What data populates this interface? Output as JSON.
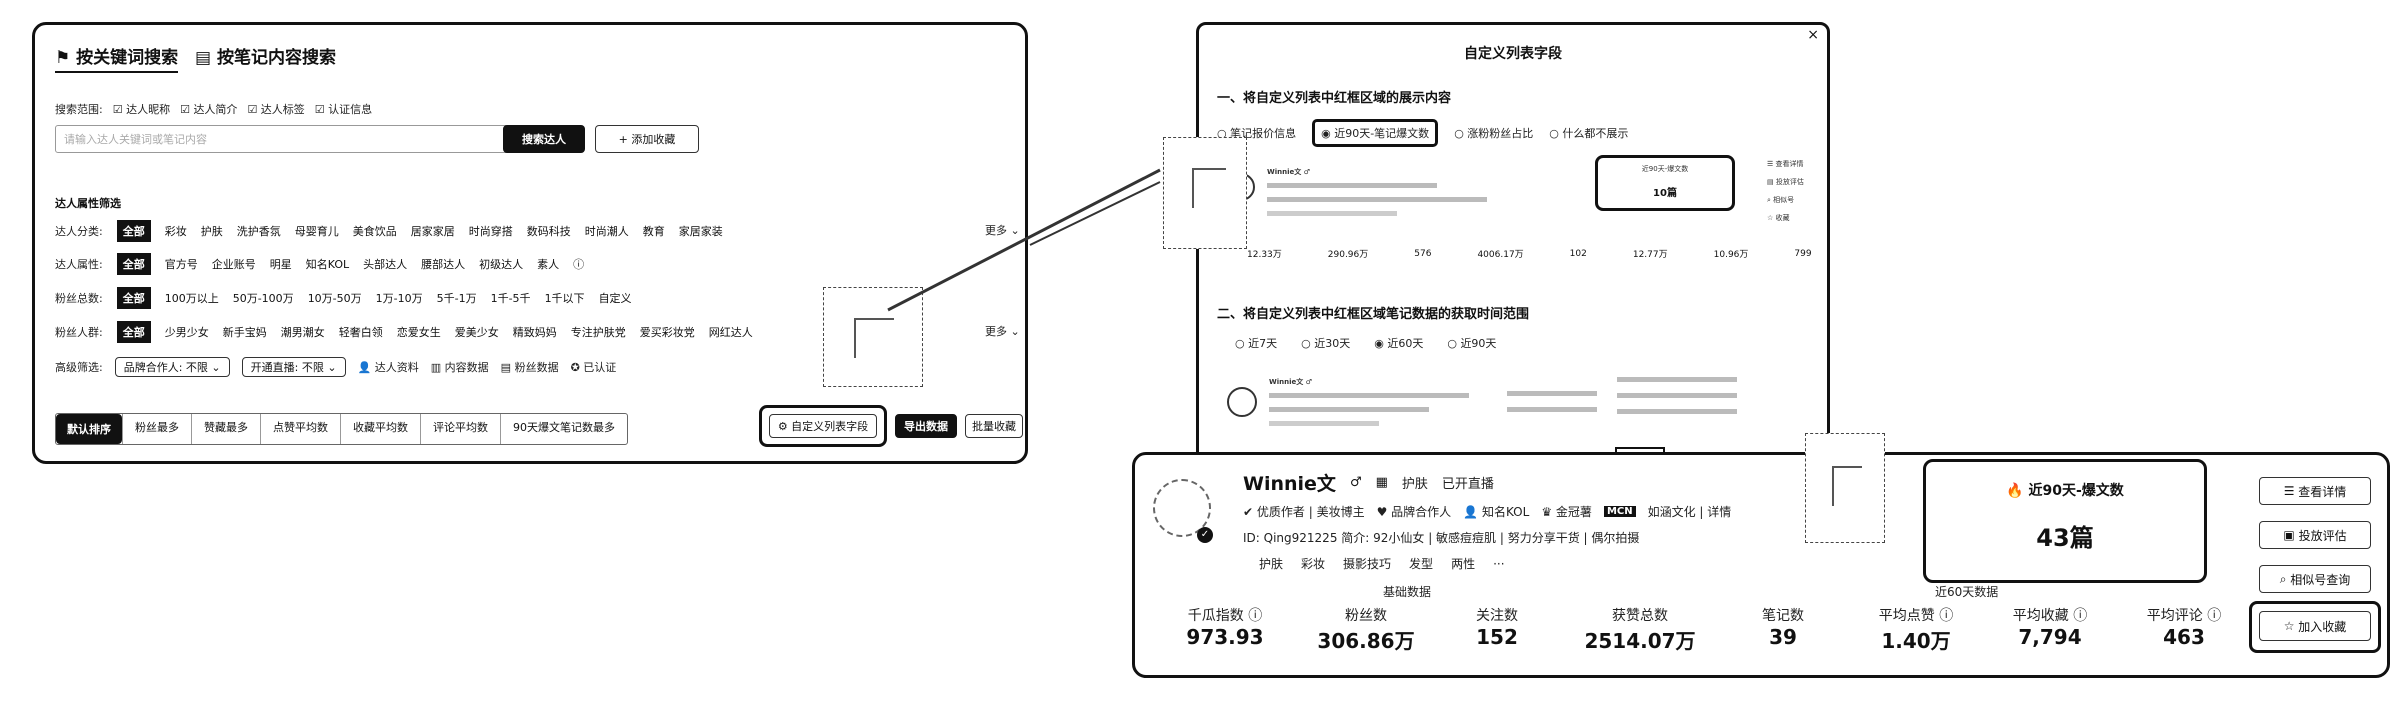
{
  "left": {
    "tabs": [
      "按关键词搜索",
      "按笔记内容搜索"
    ],
    "scope_label": "搜索范围:",
    "scope_options": [
      "达人昵称",
      "达人简介",
      "达人标签",
      "认证信息"
    ],
    "search_placeholder": "请输入达人关键词或笔记内容",
    "search_button": "搜索达人",
    "add_button": "+ 添加收藏",
    "section_title": "达人属性筛选",
    "filters": [
      {
        "label": "达人分类:",
        "options": [
          "全部",
          "彩妆",
          "护肤",
          "洗护香氛",
          "母婴育儿",
          "美食饮品",
          "居家家居",
          "时尚穿搭",
          "数码科技",
          "时尚潮人",
          "教育",
          "家居家装"
        ],
        "more": "更多 ⌄"
      },
      {
        "label": "达人属性:",
        "options": [
          "全部",
          "官方号",
          "企业账号",
          "明星",
          "知名KOL",
          "头部达人",
          "腰部达人",
          "初级达人",
          "素人"
        ],
        "more": ""
      },
      {
        "label": "粉丝总数:",
        "options": [
          "全部",
          "100万以上",
          "50万-100万",
          "10万-50万",
          "1万-10万",
          "5千-1万",
          "1千-5千",
          "1千以下",
          "自定义"
        ],
        "more": ""
      },
      {
        "label": "粉丝人群:",
        "options": [
          "全部",
          "少男少女",
          "新手宝妈",
          "潮男潮女",
          "轻奢白领",
          "恋爱女生",
          "爱美少女",
          "精致妈妈",
          "专注护肤党",
          "爱买彩妆党",
          "网红达人"
        ],
        "more": "更多 ⌄"
      }
    ],
    "adv_label": "高级筛选:",
    "adv_selects": [
      "品牌合作人: 不限",
      "开通直播: 不限"
    ],
    "adv_links": [
      "达人资料",
      "内容数据",
      "粉丝数据",
      "已认证"
    ],
    "sort_tabs": [
      "默认排序",
      "粉丝最多",
      "赞藏最多",
      "点赞平均数",
      "收藏平均数",
      "评论平均数",
      "90天爆文笔记数最多"
    ],
    "custom_button": "自定义列表字段",
    "right_buttons": [
      "导出数据",
      "批量收藏"
    ]
  },
  "modal": {
    "title": "自定义列表字段",
    "close": "×",
    "section1": "一、将自定义列表中红框区域的展示内容",
    "s1_options": [
      "笔记报价信息",
      "近90天-笔记爆文数",
      "涨粉粉丝占比",
      "什么都不展示"
    ],
    "s1_selected": 1,
    "s2_title": "二、将自定义列表中红框区域笔记数据的获取时间范围",
    "s2_options": [
      "近7天",
      "近30天",
      "近60天",
      "近90天"
    ],
    "s2_selected": 2,
    "preview_name": "Winnie文 ♂",
    "preview_box_title": "近90天-爆文数",
    "preview_box_value": "10篇",
    "preview_stats": [
      "12.33万",
      "290.96万",
      "576",
      "4006.17万",
      "102",
      "12.77万",
      "10.96万",
      "799"
    ]
  },
  "detail": {
    "name": "Winnie文",
    "gender": "♂",
    "tags_top": [
      "护肤",
      "已开直播"
    ],
    "badges": [
      "优质作者 | 美妆博主",
      "品牌合作人",
      "知名KOL",
      "金冠薯",
      "MCN",
      "如涵文化 | 详情"
    ],
    "id_line": "ID: Qing921225   简介: 92小仙女 | 敏感痘痘肌 | 努力分享干货 | 偶尔拍摄",
    "topics": [
      "护肤",
      "彩妆",
      "摄影技巧",
      "发型",
      "两性",
      "···"
    ],
    "basic_label": "基础数据",
    "recent_label": "近60天数据",
    "highlight_title": "近90天-爆文数",
    "highlight_value": "43篇",
    "stats": [
      {
        "label": "千瓜指数 ⓘ",
        "value": "973.93"
      },
      {
        "label": "粉丝数",
        "value": "306.86万"
      },
      {
        "label": "关注数",
        "value": "152"
      },
      {
        "label": "获赞总数",
        "value": "2514.07万"
      },
      {
        "label": "笔记数",
        "value": "39"
      },
      {
        "label": "平均点赞 ⓘ",
        "value": "1.40万"
      },
      {
        "label": "平均收藏 ⓘ",
        "value": "7,794"
      },
      {
        "label": "平均评论 ⓘ",
        "value": "463"
      }
    ],
    "actions": [
      "查看详情",
      "投放评估",
      "相似号查询",
      "加入收藏"
    ]
  }
}
